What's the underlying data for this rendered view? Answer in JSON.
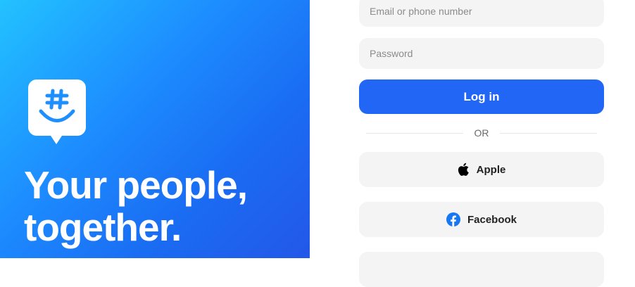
{
  "hero": {
    "tagline_line1": "Your people,",
    "tagline_line2": "together.",
    "brand_color": "#1d8cff"
  },
  "login_form": {
    "email_placeholder": "Email or phone number",
    "password_placeholder": "Password",
    "login_label": "Log in",
    "divider_text": "OR",
    "accent_color": "#2266f5",
    "social_buttons": [
      {
        "label": "Apple",
        "icon": "apple-icon"
      },
      {
        "label": "Facebook",
        "icon": "facebook-icon"
      }
    ]
  }
}
